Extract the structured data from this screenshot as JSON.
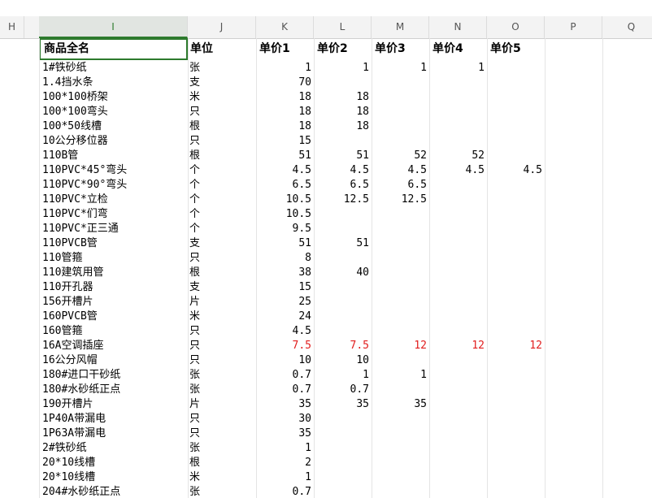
{
  "columns": [
    "H",
    "I",
    "J",
    "K",
    "L",
    "M",
    "N",
    "O",
    "P",
    "Q"
  ],
  "selected_column": "I",
  "header": {
    "name": "商品全名",
    "unit": "单位",
    "p1": "单价1",
    "p2": "单价2",
    "p3": "单价3",
    "p4": "单价4",
    "p5": "单价5"
  },
  "rows": [
    {
      "name": "1#铁砂纸",
      "unit": "张",
      "p1": "1",
      "p2": "1",
      "p3": "1",
      "p4": "1",
      "p5": ""
    },
    {
      "name": "1.4挡水条",
      "unit": "支",
      "p1": "70",
      "p2": "",
      "p3": "",
      "p4": "",
      "p5": ""
    },
    {
      "name": "100*100桥架",
      "unit": "米",
      "p1": "18",
      "p2": "18",
      "p3": "",
      "p4": "",
      "p5": ""
    },
    {
      "name": "100*100弯头",
      "unit": "只",
      "p1": "18",
      "p2": "18",
      "p3": "",
      "p4": "",
      "p5": ""
    },
    {
      "name": "100*50线槽",
      "unit": "根",
      "p1": "18",
      "p2": "18",
      "p3": "",
      "p4": "",
      "p5": ""
    },
    {
      "name": "10公分移位器",
      "unit": "只",
      "p1": "15",
      "p2": "",
      "p3": "",
      "p4": "",
      "p5": ""
    },
    {
      "name": "110B管",
      "unit": "根",
      "p1": "51",
      "p2": "51",
      "p3": "52",
      "p4": "52",
      "p5": ""
    },
    {
      "name": "110PVC*45°弯头",
      "unit": "个",
      "p1": "4.5",
      "p2": "4.5",
      "p3": "4.5",
      "p4": "4.5",
      "p5": "4.5"
    },
    {
      "name": "110PVC*90°弯头",
      "unit": "个",
      "p1": "6.5",
      "p2": "6.5",
      "p3": "6.5",
      "p4": "",
      "p5": ""
    },
    {
      "name": "110PVC*立检",
      "unit": "个",
      "p1": "10.5",
      "p2": "12.5",
      "p3": "12.5",
      "p4": "",
      "p5": ""
    },
    {
      "name": "110PVC*们弯",
      "unit": "个",
      "p1": "10.5",
      "p2": "",
      "p3": "",
      "p4": "",
      "p5": ""
    },
    {
      "name": "110PVC*正三通",
      "unit": "个",
      "p1": "9.5",
      "p2": "",
      "p3": "",
      "p4": "",
      "p5": ""
    },
    {
      "name": "110PVCB管",
      "unit": "支",
      "p1": "51",
      "p2": "51",
      "p3": "",
      "p4": "",
      "p5": ""
    },
    {
      "name": "110管箍",
      "unit": "只",
      "p1": "8",
      "p2": "",
      "p3": "",
      "p4": "",
      "p5": ""
    },
    {
      "name": "110建筑用管",
      "unit": "根",
      "p1": "38",
      "p2": "40",
      "p3": "",
      "p4": "",
      "p5": ""
    },
    {
      "name": "110开孔器",
      "unit": "支",
      "p1": "15",
      "p2": "",
      "p3": "",
      "p4": "",
      "p5": ""
    },
    {
      "name": "156开槽片",
      "unit": "片",
      "p1": "25",
      "p2": "",
      "p3": "",
      "p4": "",
      "p5": ""
    },
    {
      "name": "160PVCB管",
      "unit": "米",
      "p1": "24",
      "p2": "",
      "p3": "",
      "p4": "",
      "p5": ""
    },
    {
      "name": "160管箍",
      "unit": "只",
      "p1": "4.5",
      "p2": "",
      "p3": "",
      "p4": "",
      "p5": ""
    },
    {
      "name": "16A空调插座",
      "unit": "只",
      "p1": "7.5",
      "p2": "7.5",
      "p3": "12",
      "p4": "12",
      "p5": "12",
      "red": true
    },
    {
      "name": "16公分风帽",
      "unit": "只",
      "p1": "10",
      "p2": "10",
      "p3": "",
      "p4": "",
      "p5": ""
    },
    {
      "name": "180#进口干砂纸",
      "unit": "张",
      "p1": "0.7",
      "p2": "1",
      "p3": "1",
      "p4": "",
      "p5": ""
    },
    {
      "name": "180#水砂纸正点",
      "unit": "张",
      "p1": "0.7",
      "p2": "0.7",
      "p3": "",
      "p4": "",
      "p5": ""
    },
    {
      "name": "190开槽片",
      "unit": "片",
      "p1": "35",
      "p2": "35",
      "p3": "35",
      "p4": "",
      "p5": ""
    },
    {
      "name": "1P40A带漏电",
      "unit": "只",
      "p1": "30",
      "p2": "",
      "p3": "",
      "p4": "",
      "p5": ""
    },
    {
      "name": "1P63A带漏电",
      "unit": "只",
      "p1": "35",
      "p2": "",
      "p3": "",
      "p4": "",
      "p5": ""
    },
    {
      "name": "2#铁砂纸",
      "unit": "张",
      "p1": "1",
      "p2": "",
      "p3": "",
      "p4": "",
      "p5": ""
    },
    {
      "name": "20*10线槽",
      "unit": "根",
      "p1": "2",
      "p2": "",
      "p3": "",
      "p4": "",
      "p5": ""
    },
    {
      "name": "20*10线槽",
      "unit": "米",
      "p1": "1",
      "p2": "",
      "p3": "",
      "p4": "",
      "p5": ""
    },
    {
      "name": "204#水砂纸正点",
      "unit": "张",
      "p1": "0.7",
      "p2": "",
      "p3": "",
      "p4": "",
      "p5": ""
    }
  ],
  "colors": {
    "selection": "#2d7a2d",
    "highlight_text": "#e11d1d",
    "header_bg": "#f3f3f3"
  }
}
